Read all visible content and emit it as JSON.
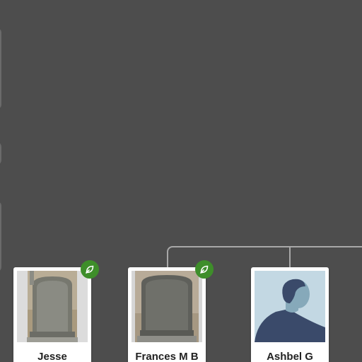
{
  "tree": {
    "people": [
      {
        "name": "Jesse",
        "photo": "gravestone-photo",
        "has_hint": true
      },
      {
        "name": "Frances M B",
        "photo": "gravestone-photo",
        "has_hint": true
      },
      {
        "name": "Ashbel G",
        "photo": "default-avatar-male",
        "has_hint": false
      }
    ]
  },
  "colors": {
    "canvas_background": "#4d4d4d",
    "connector": "#a8a8a8",
    "hint_badge": "#3e8e2a",
    "card_background": "#ffffff",
    "avatar_background": "#c3d8e3",
    "avatar_figure": "#3a4a6a"
  },
  "icons": {
    "hint": "leaf-icon"
  }
}
